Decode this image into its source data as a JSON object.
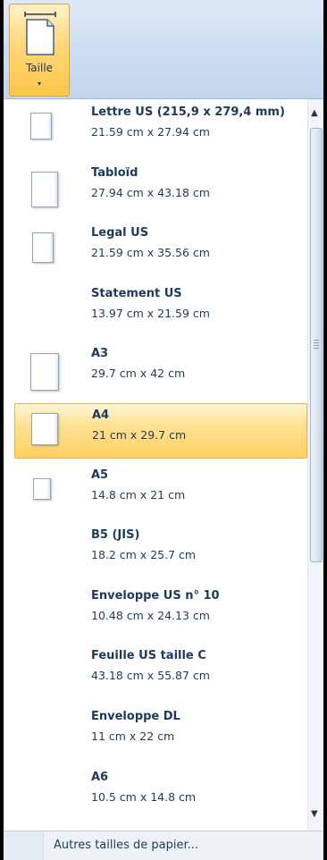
{
  "ribbon": {
    "size_button": {
      "label": "Taille",
      "icon": "page-size-icon",
      "dropdown": "▾"
    }
  },
  "paper_sizes": [
    {
      "title": "Lettre US (215,9 x 279,4 mm)",
      "size": "21.59 cm x 27.94 cm",
      "thumb": true
    },
    {
      "title": "Tabloïd",
      "size": "27.94 cm x 43.18 cm",
      "thumb": true
    },
    {
      "title": "Legal US",
      "size": "21.59 cm x 35.56 cm",
      "thumb": true
    },
    {
      "title": "Statement US",
      "size": "13.97 cm x 21.59 cm",
      "thumb": false
    },
    {
      "title": "A3",
      "size": "29.7 cm x 42 cm",
      "thumb": true
    },
    {
      "title": "A4",
      "size": "21 cm x 29.7 cm",
      "thumb": true,
      "selected": true
    },
    {
      "title": "A5",
      "size": "14.8 cm x 21 cm",
      "thumb": true
    },
    {
      "title": "B5 (JIS)",
      "size": "18.2 cm x 25.7 cm",
      "thumb": false
    },
    {
      "title": "Enveloppe US n° 10",
      "size": "10.48 cm x 24.13 cm",
      "thumb": false
    },
    {
      "title": "Feuille US taille C",
      "size": "43.18 cm x 55.87 cm",
      "thumb": false
    },
    {
      "title": "Enveloppe DL",
      "size": "11 cm x 22 cm",
      "thumb": false
    },
    {
      "title": "A6",
      "size": "10.5 cm x 14.8 cm",
      "thumb": false
    }
  ],
  "scrollbar": {
    "up": "▲",
    "down": "▼"
  },
  "footer": {
    "more_sizes": "Autres tailles de papier..."
  },
  "colors": {
    "selection": "#ffd064",
    "text": "#1c3b5c",
    "ribbon": "#cfdff3"
  }
}
